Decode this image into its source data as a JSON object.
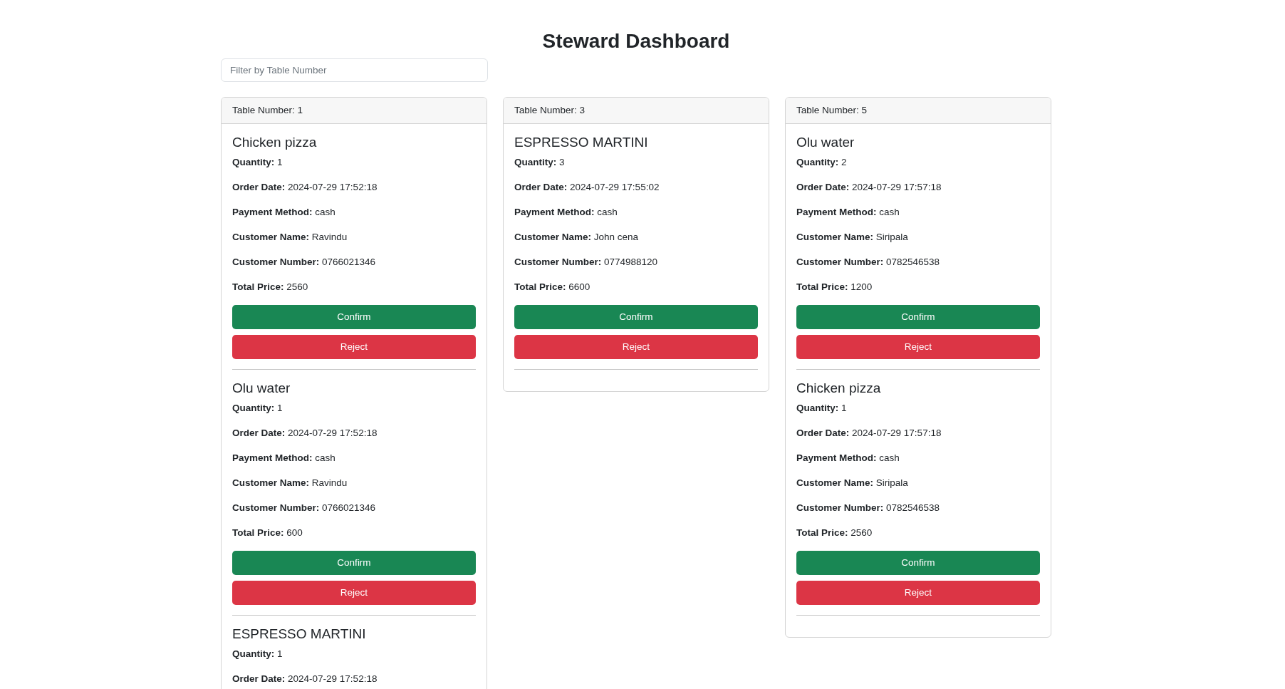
{
  "page": {
    "title": "Steward Dashboard"
  },
  "filter": {
    "placeholder": "Filter by Table Number"
  },
  "tables": [
    {
      "header": "Table Number: 1",
      "orders": [
        {
          "name": "Chicken pizza",
          "fields": [
            {
              "label": "Quantity:",
              "value": "1"
            },
            {
              "label": "Order Date:",
              "value": "2024-07-29 17:52:18"
            },
            {
              "label": "Payment Method:",
              "value": "cash"
            },
            {
              "label": "Customer Name:",
              "value": "Ravindu"
            },
            {
              "label": "Customer Number:",
              "value": "0766021346"
            },
            {
              "label": "Total Price:",
              "value": "2560"
            }
          ],
          "buttons": [
            {
              "label": "Confirm",
              "kind": "confirm"
            },
            {
              "label": "Reject",
              "kind": "reject"
            }
          ]
        },
        {
          "name": "Olu water",
          "fields": [
            {
              "label": "Quantity:",
              "value": "1"
            },
            {
              "label": "Order Date:",
              "value": "2024-07-29 17:52:18"
            },
            {
              "label": "Payment Method:",
              "value": "cash"
            },
            {
              "label": "Customer Name:",
              "value": "Ravindu"
            },
            {
              "label": "Customer Number:",
              "value": "0766021346"
            },
            {
              "label": "Total Price:",
              "value": "600"
            }
          ],
          "buttons": [
            {
              "label": "Confirm",
              "kind": "confirm"
            },
            {
              "label": "Reject",
              "kind": "reject"
            }
          ]
        },
        {
          "name": "ESPRESSO MARTINI",
          "fields": [
            {
              "label": "Quantity:",
              "value": "1"
            },
            {
              "label": "Order Date:",
              "value": "2024-07-29 17:52:18"
            }
          ]
        }
      ]
    },
    {
      "header": "Table Number: 3",
      "orders": [
        {
          "name": "ESPRESSO MARTINI",
          "fields": [
            {
              "label": "Quantity:",
              "value": "3"
            },
            {
              "label": "Order Date:",
              "value": "2024-07-29 17:55:02"
            },
            {
              "label": "Payment Method:",
              "value": "cash"
            },
            {
              "label": "Customer Name:",
              "value": "John cena"
            },
            {
              "label": "Customer Number:",
              "value": "0774988120"
            },
            {
              "label": "Total Price:",
              "value": "6600"
            }
          ],
          "buttons": [
            {
              "label": "Confirm",
              "kind": "confirm"
            },
            {
              "label": "Reject",
              "kind": "reject"
            }
          ]
        }
      ]
    },
    {
      "header": "Table Number: 5",
      "orders": [
        {
          "name": "Olu water",
          "fields": [
            {
              "label": "Quantity:",
              "value": "2"
            },
            {
              "label": "Order Date:",
              "value": "2024-07-29 17:57:18"
            },
            {
              "label": "Payment Method:",
              "value": "cash"
            },
            {
              "label": "Customer Name:",
              "value": "Siripala"
            },
            {
              "label": "Customer Number:",
              "value": "0782546538"
            },
            {
              "label": "Total Price:",
              "value": "1200"
            }
          ],
          "buttons": [
            {
              "label": "Confirm",
              "kind": "confirm"
            },
            {
              "label": "Reject",
              "kind": "reject"
            }
          ]
        },
        {
          "name": "Chicken pizza",
          "fields": [
            {
              "label": "Quantity:",
              "value": "1"
            },
            {
              "label": "Order Date:",
              "value": "2024-07-29 17:57:18"
            },
            {
              "label": "Payment Method:",
              "value": "cash"
            },
            {
              "label": "Customer Name:",
              "value": "Siripala"
            },
            {
              "label": "Customer Number:",
              "value": "0782546538"
            },
            {
              "label": "Total Price:",
              "value": "2560"
            }
          ],
          "buttons": [
            {
              "label": "Confirm",
              "kind": "confirm"
            },
            {
              "label": "Reject",
              "kind": "reject"
            }
          ]
        }
      ]
    }
  ]
}
